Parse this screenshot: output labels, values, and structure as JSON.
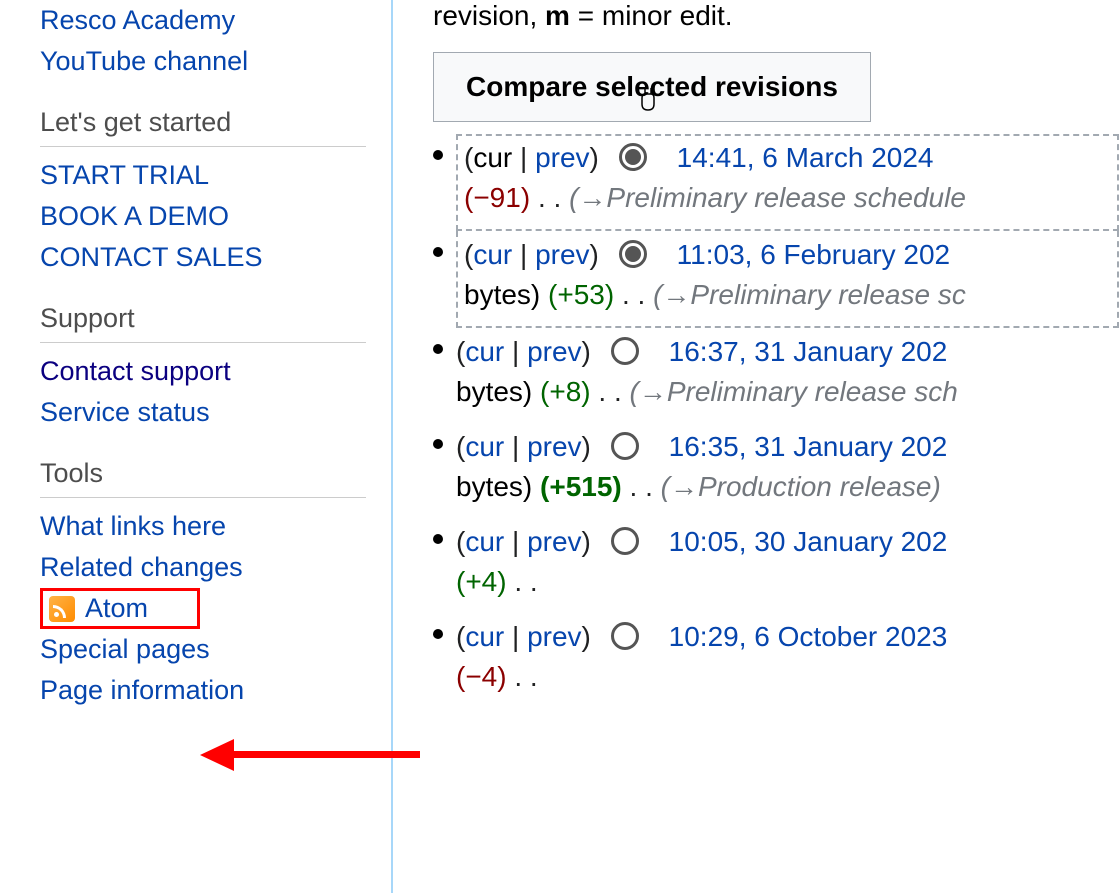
{
  "sidebar": {
    "top_links": [
      {
        "label": "Resco Academy",
        "visited": false
      },
      {
        "label": "YouTube channel",
        "visited": false
      }
    ],
    "sections": [
      {
        "heading": "Let's get started",
        "items": [
          {
            "label": "START TRIAL"
          },
          {
            "label": "BOOK A DEMO"
          },
          {
            "label": "CONTACT SALES"
          }
        ]
      },
      {
        "heading": "Support",
        "items": [
          {
            "label": "Contact support",
            "visited": true
          },
          {
            "label": "Service status"
          }
        ]
      },
      {
        "heading": "Tools",
        "items": [
          {
            "label": "What links here"
          },
          {
            "label": "Related changes"
          },
          {
            "label": "Atom",
            "icon": "rss"
          },
          {
            "label": "Special pages"
          },
          {
            "label": "Page information"
          }
        ]
      }
    ]
  },
  "legend_fragment": {
    "prefix": "revision, ",
    "bold": "m",
    "suffix": " = minor edit."
  },
  "compare_button": "Compare selected revisions",
  "labels": {
    "cur": "cur",
    "prev": "prev",
    "bytes": "bytes",
    "dots": ". ."
  },
  "revisions": [
    {
      "cur_link": false,
      "prev_link": true,
      "radio_selected": true,
      "timestamp": "14:41, 6 March 2024",
      "size_change": "−91",
      "size_class": "neg",
      "show_bytes_prefix": false,
      "comment_section": "Preliminary release schedule",
      "comment_trail": "",
      "border": "dashed-all"
    },
    {
      "cur_link": true,
      "prev_link": true,
      "radio_selected": true,
      "timestamp": "11:03, 6 February 202",
      "size_change": "+53",
      "size_class": "pos",
      "show_bytes_prefix": true,
      "comment_section": "Preliminary release sc",
      "comment_trail": "",
      "border": "dashed-bottom"
    },
    {
      "cur_link": true,
      "prev_link": true,
      "radio_selected": false,
      "timestamp": "16:37, 31 January 202",
      "size_change": "+8",
      "size_class": "pos",
      "show_bytes_prefix": true,
      "comment_section": "Preliminary release sch",
      "comment_trail": "",
      "border": ""
    },
    {
      "cur_link": true,
      "prev_link": true,
      "radio_selected": false,
      "timestamp": "16:35, 31 January 202",
      "size_change": "+515",
      "size_class": "pos bold",
      "show_bytes_prefix": true,
      "comment_section": "Production release",
      "comment_trail": ")",
      "border": ""
    },
    {
      "cur_link": true,
      "prev_link": true,
      "radio_selected": false,
      "timestamp": "10:05, 30 January 202",
      "size_change": "+4",
      "size_class": "pos",
      "show_bytes_prefix": false,
      "comment_section": "",
      "comment_trail": "",
      "border": ""
    },
    {
      "cur_link": true,
      "prev_link": true,
      "radio_selected": false,
      "timestamp": "10:29, 6 October 2023",
      "size_change": "−4",
      "size_class": "neg",
      "show_bytes_prefix": false,
      "comment_section": "",
      "comment_trail": "",
      "border": ""
    }
  ]
}
